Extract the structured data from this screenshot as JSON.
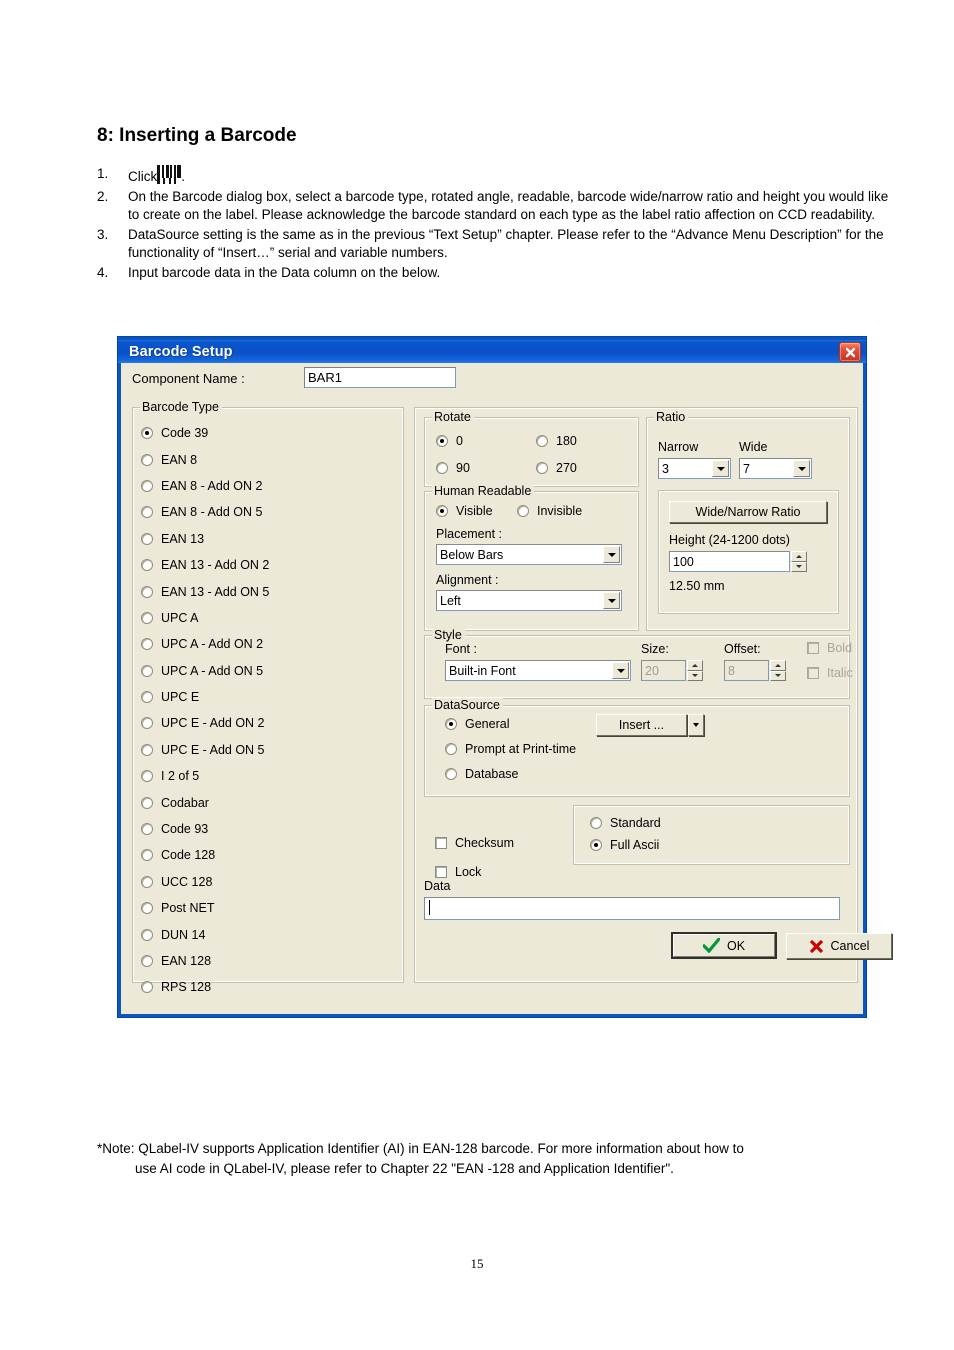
{
  "document": {
    "heading": "8: Inserting a Barcode",
    "steps": [
      {
        "num": "1.",
        "pre": "Click",
        "post": ".",
        "icon": "barcode-icon"
      },
      {
        "num": "2.",
        "text": "On the Barcode dialog box, select a barcode type, rotated angle, readable, barcode wide/narrow ratio and height you would like to create on the label. Please acknowledge the barcode standard on each type as the label ratio affection on CCD readability."
      },
      {
        "num": "3.",
        "text": "DataSource setting is the same as in the previous “Text Setup” chapter. Please refer to the “Advance Menu Description” for the functionality of “Insert…” serial and variable numbers."
      },
      {
        "num": "4.",
        "text": "Input barcode data in the Data column on the below."
      }
    ],
    "note_line1": "*Note: QLabel-IV supports Application Identifier (AI) in EAN-128 barcode. For more information about how to",
    "note_line2": "use AI code in QLabel-IV, please refer to Chapter 22 \"EAN -128 and Application Identifier\".",
    "page_number": "15"
  },
  "dialog": {
    "title": "Barcode Setup",
    "close_icon": "close-icon",
    "titlebar_color": "#0a55cc",
    "face_color": "#ece9d8",
    "component_name": {
      "label": "Component Name :",
      "value": "BAR1"
    },
    "barcode_type": {
      "legend": "Barcode Type",
      "selected": "Code 39",
      "items": [
        "Code 39",
        "EAN 8",
        "EAN 8 - Add ON 2",
        "EAN 8 - Add ON 5",
        "EAN 13",
        "EAN 13 - Add ON 2",
        "EAN 13 - Add ON 5",
        "UPC A",
        "UPC A - Add ON 2",
        "UPC A - Add ON 5",
        "UPC E",
        "UPC E - Add ON 2",
        "UPC E - Add ON 5",
        "I 2 of 5",
        "Codabar",
        "Code 93",
        "Code 128",
        "UCC 128",
        "Post NET",
        "DUN 14",
        "EAN 128",
        "RPS 128"
      ]
    },
    "rotate": {
      "legend": "Rotate",
      "options": [
        "0",
        "180",
        "90",
        "270"
      ],
      "selected": "0"
    },
    "human_readable": {
      "legend": "Human Readable",
      "visible_label": "Visible",
      "invisible_label": "Invisible",
      "selected": "Visible",
      "placement_label": "Placement :",
      "placement_value": "Below Bars",
      "alignment_label": "Alignment :",
      "alignment_value": "Left"
    },
    "ratio": {
      "legend": "Ratio",
      "narrow_label": "Narrow",
      "narrow_value": "3",
      "wide_label": "Wide",
      "wide_value": "7",
      "button_label": "Wide/Narrow Ratio",
      "height_label": "Height (24-1200 dots)",
      "height_value": "100",
      "height_mm": "12.50 mm"
    },
    "style": {
      "legend": "Style",
      "font_label": "Font :",
      "font_value": "Built-in Font",
      "size_label": "Size:",
      "size_value": "20",
      "offset_label": "Offset:",
      "offset_value": "8",
      "bold_label": "Bold",
      "italic_label": "Italic"
    },
    "datasource": {
      "legend": "DataSource",
      "options": [
        "General",
        "Prompt at Print-time",
        "Database"
      ],
      "selected": "General",
      "insert_label": "Insert ..."
    },
    "checksum_label": "Checksum",
    "lock_label": "Lock",
    "ascii": {
      "options": [
        "Standard",
        "Full  Ascii"
      ],
      "selected": "Full  Ascii"
    },
    "data": {
      "label": "Data",
      "value": ""
    },
    "buttons": {
      "ok": "OK",
      "cancel": "Cancel"
    }
  }
}
